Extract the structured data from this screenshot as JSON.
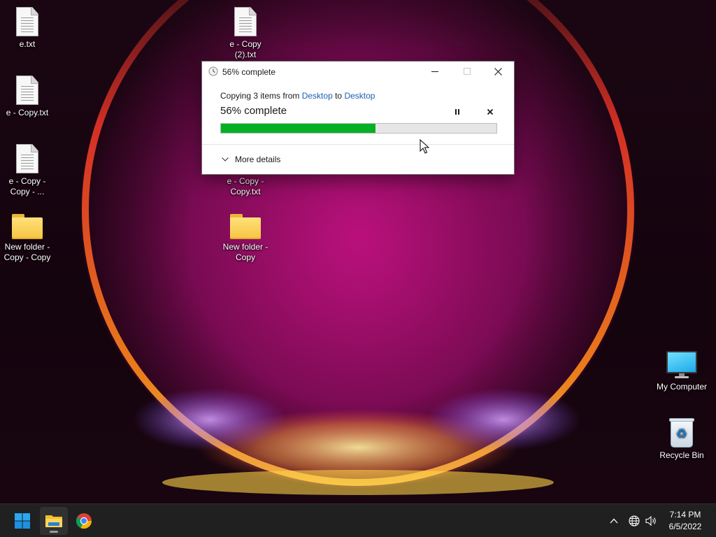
{
  "desktop": {
    "icons_left": [
      {
        "label": "e.txt",
        "type": "text-file-icon"
      },
      {
        "label": "e - Copy.txt",
        "type": "text-file-icon"
      },
      {
        "label": "e - Copy - Copy - ...",
        "type": "text-file-icon"
      },
      {
        "label": "New folder - Copy - Copy",
        "type": "folder-icon"
      }
    ],
    "icons_middle": [
      {
        "label": "e - Copy (2).txt",
        "type": "text-file-icon"
      },
      {
        "label": "e - Copy - Copy.txt",
        "type": "text-file-icon"
      },
      {
        "label": "New folder - Copy",
        "type": "folder-icon"
      }
    ],
    "icons_right": [
      {
        "label": "My Computer",
        "type": "monitor-icon"
      },
      {
        "label": "Recycle Bin",
        "type": "recycle-bin-icon"
      }
    ]
  },
  "dialog": {
    "title": "56% complete",
    "copying_prefix": "Copying 3 items from",
    "source": "Desktop",
    "to_word": "to",
    "destination": "Desktop",
    "status": "56% complete",
    "progress_percent": 56,
    "more_details": "More details",
    "progress_color": "#06b025"
  },
  "taskbar": {
    "apps": [
      "windows-start-icon",
      "file-explorer-icon",
      "chrome-icon"
    ],
    "tray": [
      "chevron-up-icon",
      "network-globe-icon",
      "speaker-icon"
    ],
    "time": "7:14 PM",
    "date": "6/5/2022"
  }
}
